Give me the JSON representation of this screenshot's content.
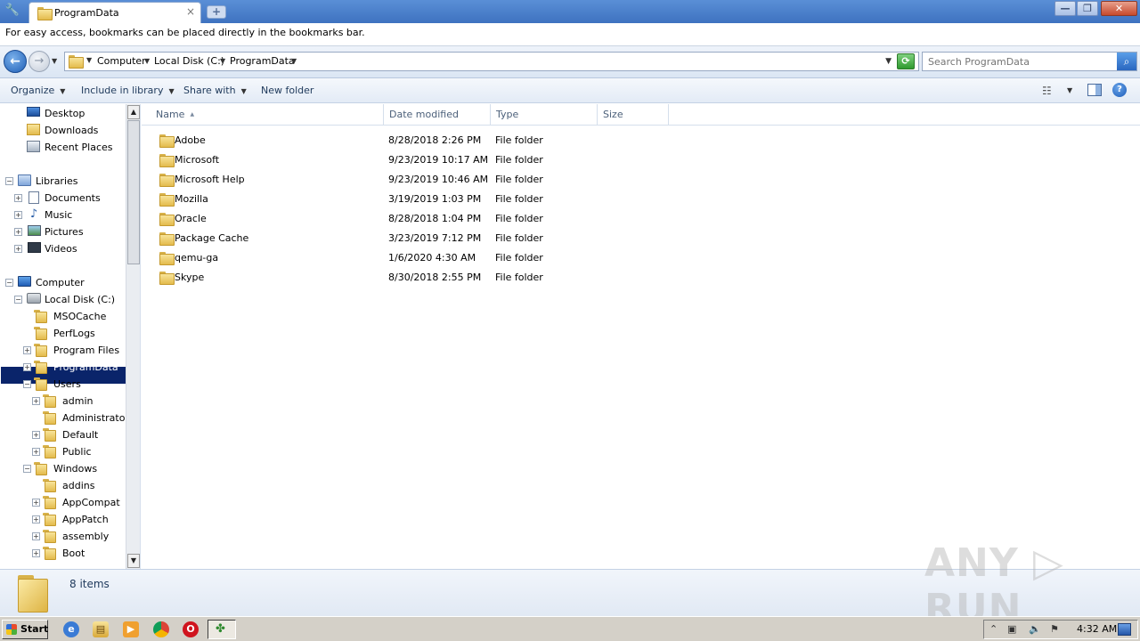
{
  "browser": {
    "tab_title": "ProgramData",
    "tab_close": "×",
    "new_tab": "+",
    "bookmark_message": "For easy access, bookmarks can be placed directly in the bookmarks bar.",
    "window_buttons": {
      "minimize": "—",
      "maximize": "❐",
      "close": "✕"
    }
  },
  "address": {
    "crumbs": [
      "Computer",
      "Local Disk (C:)",
      "ProgramData"
    ],
    "search_placeholder": "Search ProgramData"
  },
  "commands": {
    "organize": "Organize",
    "include_in_library": "Include in library",
    "share_with": "Share with",
    "new_folder": "New folder",
    "help": "?"
  },
  "nav": {
    "favorites": [
      "Desktop",
      "Downloads",
      "Recent Places"
    ],
    "libraries": {
      "label": "Libraries",
      "items": [
        "Documents",
        "Music",
        "Pictures",
        "Videos"
      ]
    },
    "computer": {
      "label": "Computer"
    },
    "local_disk": {
      "label": "Local Disk (C:)"
    },
    "disk_items": [
      "MSOCache",
      "PerfLogs",
      "Program Files",
      "ProgramData",
      "Users"
    ],
    "users_items": [
      "admin",
      "Administrator",
      "Default",
      "Public"
    ],
    "windows": {
      "label": "Windows"
    },
    "windows_items": [
      "addins",
      "AppCompat",
      "AppPatch",
      "assembly",
      "Boot"
    ]
  },
  "columns": {
    "name": "Name",
    "date": "Date modified",
    "type": "Type",
    "size": "Size"
  },
  "files": [
    {
      "name": "Adobe",
      "date": "8/28/2018 2:26 PM",
      "type": "File folder"
    },
    {
      "name": "Microsoft",
      "date": "9/23/2019 10:17 AM",
      "type": "File folder"
    },
    {
      "name": "Microsoft Help",
      "date": "9/23/2019 10:46 AM",
      "type": "File folder"
    },
    {
      "name": "Mozilla",
      "date": "3/19/2019 1:03 PM",
      "type": "File folder"
    },
    {
      "name": "Oracle",
      "date": "8/28/2018 1:04 PM",
      "type": "File folder"
    },
    {
      "name": "Package Cache",
      "date": "3/23/2019 7:12 PM",
      "type": "File folder"
    },
    {
      "name": "qemu-ga",
      "date": "1/6/2020 4:30 AM",
      "type": "File folder"
    },
    {
      "name": "Skype",
      "date": "8/30/2018 2:55 PM",
      "type": "File folder"
    }
  ],
  "details": {
    "item_count": "8 items"
  },
  "watermark": "ANY ▷ RUN",
  "taskbar": {
    "start": "Start",
    "clock": "4:32 AM"
  }
}
